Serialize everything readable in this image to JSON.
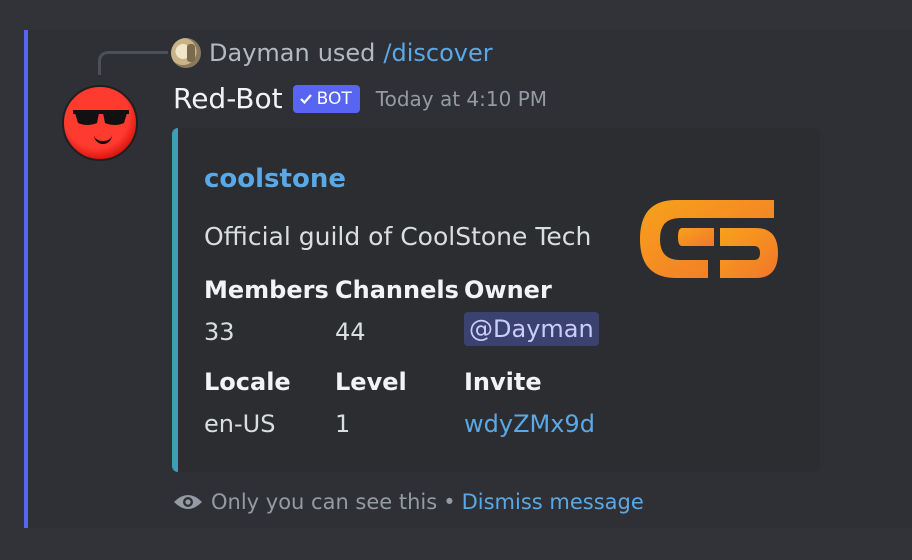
{
  "reply": {
    "user": "Dayman",
    "used_text": "used",
    "command": "/discover"
  },
  "message": {
    "author": "Red-Bot",
    "bot_tag": "BOT",
    "timestamp": "Today at 4:10 PM"
  },
  "embed": {
    "accent_color": "#3ba0b4",
    "title": "coolstone",
    "description": "Official guild of CoolStone Tech",
    "thumbnail_icon": "coolstone-logo-icon",
    "fields": [
      {
        "name": "Members",
        "value": "33"
      },
      {
        "name": "Channels",
        "value": "44"
      },
      {
        "name": "Owner",
        "value": "@Dayman"
      },
      {
        "name": "Locale",
        "value": "en-US"
      },
      {
        "name": "Level",
        "value": "1"
      },
      {
        "name": "Invite",
        "value": "wdyZMx9d"
      }
    ]
  },
  "ephemeral": {
    "note": "Only you can see this",
    "separator": "•",
    "dismiss": "Dismiss message"
  },
  "colors": {
    "brand": "#5865f2",
    "link": "#5aa9e6",
    "background": "#313338"
  }
}
